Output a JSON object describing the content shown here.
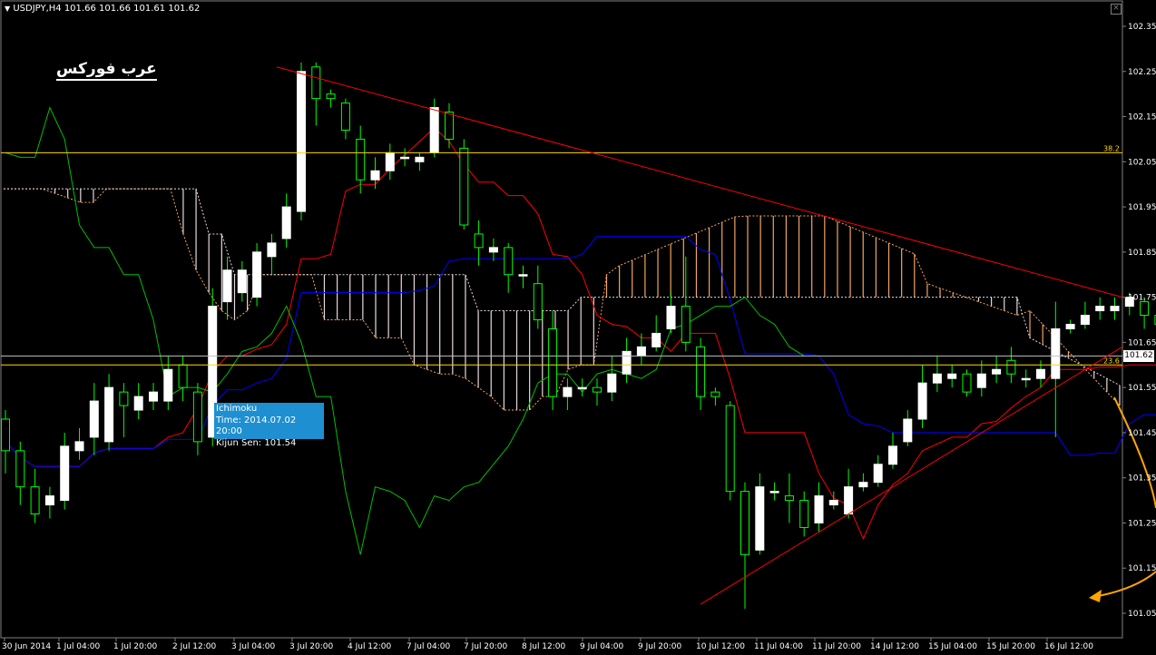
{
  "window": {
    "symbol_header": "USDJPY,H4  101.66 101.66 101.61 101.62",
    "watermark": "عرب فوركس",
    "close_icon": "close-icon",
    "menu_icon": "triangle-down-icon"
  },
  "tooltip": {
    "line1": "Ichimoku",
    "line2": "Time: 2014.07.02 20:00",
    "line3": "Kijun Sen: 101.54"
  },
  "price_tag": "101.62",
  "fib": {
    "level_382": "38.2",
    "level_236": "23.6"
  },
  "colors": {
    "background": "#000000",
    "bull_candle": "#ffffff",
    "bear_candle": "#000000",
    "candle_wick": "#00ff00",
    "tenkan": "#ff0000",
    "kijun": "#0000ff",
    "chikou": "#00c000",
    "kumo_up": "#f4a460",
    "kumo_down": "#e8d8dc",
    "trendline": "#ff0000",
    "fib_line": "#ffd700",
    "arrow": "#ffa500"
  },
  "chart_data": {
    "type": "candlestick",
    "y_ticks": [
      "102.35",
      "102.25",
      "102.15",
      "102.05",
      "101.95",
      "101.85",
      "101.75",
      "101.65",
      "101.55",
      "101.45",
      "101.35",
      "101.25",
      "101.15",
      "101.05"
    ],
    "x_ticks": [
      "30 Jun 2014",
      "1 Jul 04:00",
      "1 Jul 20:00",
      "2 Jul 12:00",
      "3 Jul 04:00",
      "3 Jul 20:00",
      "4 Jul 12:00",
      "7 Jul 04:00",
      "7 Jul 20:00",
      "8 Jul 12:00",
      "9 Jul 04:00",
      "9 Jul 20:00",
      "10 Jul 12:00",
      "11 Jul 04:00",
      "11 Jul 20:00",
      "14 Jul 12:00",
      "15 Jul 04:00",
      "15 Jul 20:00",
      "16 Jul 12:00"
    ],
    "ylim": [
      101.0,
      102.4
    ],
    "candles": [
      [
        101.48,
        101.41,
        101.5,
        101.36
      ],
      [
        101.41,
        101.33,
        101.43,
        101.29
      ],
      [
        101.33,
        101.27,
        101.37,
        101.25
      ],
      [
        101.29,
        101.31,
        101.33,
        101.26
      ],
      [
        101.3,
        101.42,
        101.45,
        101.28
      ],
      [
        101.41,
        101.43,
        101.46,
        101.39
      ],
      [
        101.44,
        101.52,
        101.56,
        101.4
      ],
      [
        101.43,
        101.55,
        101.58,
        101.41
      ],
      [
        101.54,
        101.51,
        101.56,
        101.44
      ],
      [
        101.5,
        101.53,
        101.56,
        101.48
      ],
      [
        101.52,
        101.54,
        101.56,
        101.5
      ],
      [
        101.52,
        101.59,
        101.62,
        101.5
      ],
      [
        101.6,
        101.55,
        101.62,
        101.52
      ],
      [
        101.54,
        101.43,
        101.56,
        101.4
      ],
      [
        101.44,
        101.73,
        101.77,
        101.42
      ],
      [
        101.74,
        101.81,
        101.84,
        101.7
      ],
      [
        101.76,
        101.81,
        101.83,
        101.74
      ],
      [
        101.75,
        101.85,
        101.87,
        101.73
      ],
      [
        101.84,
        101.87,
        101.89,
        101.8
      ],
      [
        101.88,
        101.95,
        101.98,
        101.86
      ],
      [
        101.94,
        102.25,
        102.27,
        101.92
      ],
      [
        102.26,
        102.19,
        102.27,
        102.13
      ],
      [
        102.2,
        102.19,
        102.21,
        102.17
      ],
      [
        102.18,
        102.12,
        102.19,
        102.1
      ],
      [
        102.1,
        102.01,
        102.13,
        101.98
      ],
      [
        102.01,
        102.03,
        102.06,
        101.99
      ],
      [
        102.03,
        102.07,
        102.09,
        102.01
      ],
      [
        102.06,
        102.06,
        102.08,
        102.04
      ],
      [
        102.05,
        102.06,
        102.07,
        102.03
      ],
      [
        102.07,
        102.17,
        102.19,
        102.06
      ],
      [
        102.16,
        102.1,
        102.18,
        102.08
      ],
      [
        102.08,
        101.91,
        102.1,
        101.9
      ],
      [
        101.89,
        101.86,
        101.92,
        101.82
      ],
      [
        101.85,
        101.86,
        101.88,
        101.83
      ],
      [
        101.86,
        101.8,
        101.87,
        101.76
      ],
      [
        101.8,
        101.8,
        101.82,
        101.77
      ],
      [
        101.78,
        101.7,
        101.82,
        101.68
      ],
      [
        101.68,
        101.53,
        101.72,
        101.5
      ],
      [
        101.53,
        101.55,
        101.57,
        101.5
      ],
      [
        101.55,
        101.55,
        101.57,
        101.53
      ],
      [
        101.55,
        101.54,
        101.57,
        101.51
      ],
      [
        101.54,
        101.58,
        101.62,
        101.52
      ],
      [
        101.58,
        101.63,
        101.66,
        101.56
      ],
      [
        101.62,
        101.64,
        101.67,
        101.6
      ],
      [
        101.64,
        101.67,
        101.71,
        101.63
      ],
      [
        101.68,
        101.73,
        101.76,
        101.67
      ],
      [
        101.73,
        101.65,
        101.84,
        101.63
      ],
      [
        101.64,
        101.53,
        101.66,
        101.5
      ],
      [
        101.54,
        101.53,
        101.55,
        101.51
      ],
      [
        101.51,
        101.32,
        101.52,
        101.3
      ],
      [
        101.32,
        101.18,
        101.34,
        101.06
      ],
      [
        101.19,
        101.33,
        101.36,
        101.18
      ],
      [
        101.32,
        101.32,
        101.34,
        101.3
      ],
      [
        101.31,
        101.3,
        101.36,
        101.25
      ],
      [
        101.3,
        101.24,
        101.32,
        101.22
      ],
      [
        101.25,
        101.31,
        101.34,
        101.23
      ],
      [
        101.29,
        101.3,
        101.32,
        101.28
      ],
      [
        101.27,
        101.33,
        101.37,
        101.26
      ],
      [
        101.33,
        101.34,
        101.36,
        101.32
      ],
      [
        101.34,
        101.38,
        101.4,
        101.33
      ],
      [
        101.38,
        101.42,
        101.45,
        101.37
      ],
      [
        101.43,
        101.48,
        101.5,
        101.42
      ],
      [
        101.48,
        101.56,
        101.6,
        101.46
      ],
      [
        101.56,
        101.58,
        101.62,
        101.54
      ],
      [
        101.57,
        101.58,
        101.6,
        101.55
      ],
      [
        101.58,
        101.54,
        101.59,
        101.53
      ],
      [
        101.55,
        101.58,
        101.61,
        101.53
      ],
      [
        101.58,
        101.59,
        101.62,
        101.56
      ],
      [
        101.61,
        101.58,
        101.64,
        101.56
      ],
      [
        101.57,
        101.57,
        101.59,
        101.55
      ],
      [
        101.57,
        101.59,
        101.61,
        101.55
      ],
      [
        101.57,
        101.68,
        101.74,
        101.44
      ],
      [
        101.68,
        101.69,
        101.7,
        101.67
      ],
      [
        101.69,
        101.71,
        101.74,
        101.68
      ],
      [
        101.72,
        101.73,
        101.75,
        101.7
      ],
      [
        101.72,
        101.73,
        101.75,
        101.7
      ],
      [
        101.73,
        101.75,
        101.76,
        101.71
      ],
      [
        101.74,
        101.71,
        101.75,
        101.68
      ],
      [
        101.71,
        101.69,
        101.73,
        101.67
      ],
      [
        101.69,
        101.64,
        101.71,
        101.63
      ],
      [
        101.65,
        101.62,
        101.66,
        101.61
      ]
    ]
  }
}
